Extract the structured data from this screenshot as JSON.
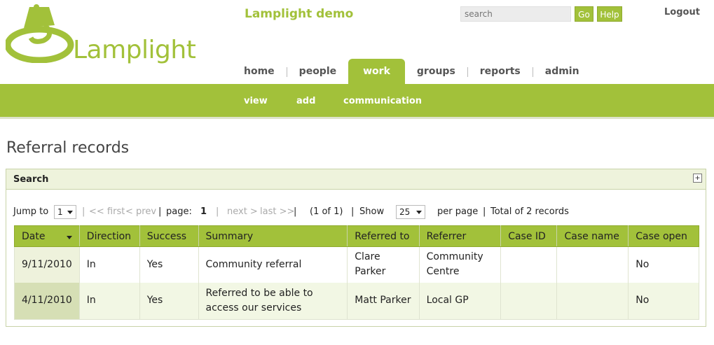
{
  "header": {
    "logo_text": "Lamplight",
    "site_title": "Lamplight demo",
    "search_placeholder": "search",
    "go_label": "Go",
    "help_label": "Help",
    "logout_label": "Logout"
  },
  "nav": {
    "items": [
      "home",
      "people",
      "work",
      "groups",
      "reports",
      "admin"
    ],
    "active": "work"
  },
  "subnav": {
    "items": [
      "view",
      "add",
      "communication"
    ]
  },
  "page": {
    "title": "Referral records"
  },
  "search_panel": {
    "label": "Search"
  },
  "pager": {
    "jump_label": "Jump to",
    "jump_value": "1",
    "first": "<< first",
    "prev": "< prev",
    "page_label": "page:",
    "page_value": "1",
    "next": "next >",
    "last": "last >>",
    "page_count": "(1 of 1)",
    "show_label": "Show",
    "show_value": "25",
    "per_page_label": "per page",
    "total": "Total of 2 records"
  },
  "table": {
    "columns": [
      "Date",
      "Direction",
      "Success",
      "Summary",
      "Referred to",
      "Referrer",
      "Case ID",
      "Case name",
      "Case open"
    ],
    "rows": [
      {
        "date": "9/11/2010",
        "direction": "In",
        "success": "Yes",
        "summary": "Community referral",
        "referred_to": "Clare Parker",
        "referrer": "Community Centre",
        "case_id": "",
        "case_name": "",
        "case_open": "No"
      },
      {
        "date": "4/11/2010",
        "direction": "In",
        "success": "Yes",
        "summary": "Referred to be able to access our services",
        "referred_to": "Matt Parker",
        "referrer": "Local GP",
        "case_id": "",
        "case_name": "",
        "case_open": "No"
      }
    ]
  },
  "colors": {
    "brand_green": "#a2c13a",
    "panel_bg": "#eef3dc"
  }
}
